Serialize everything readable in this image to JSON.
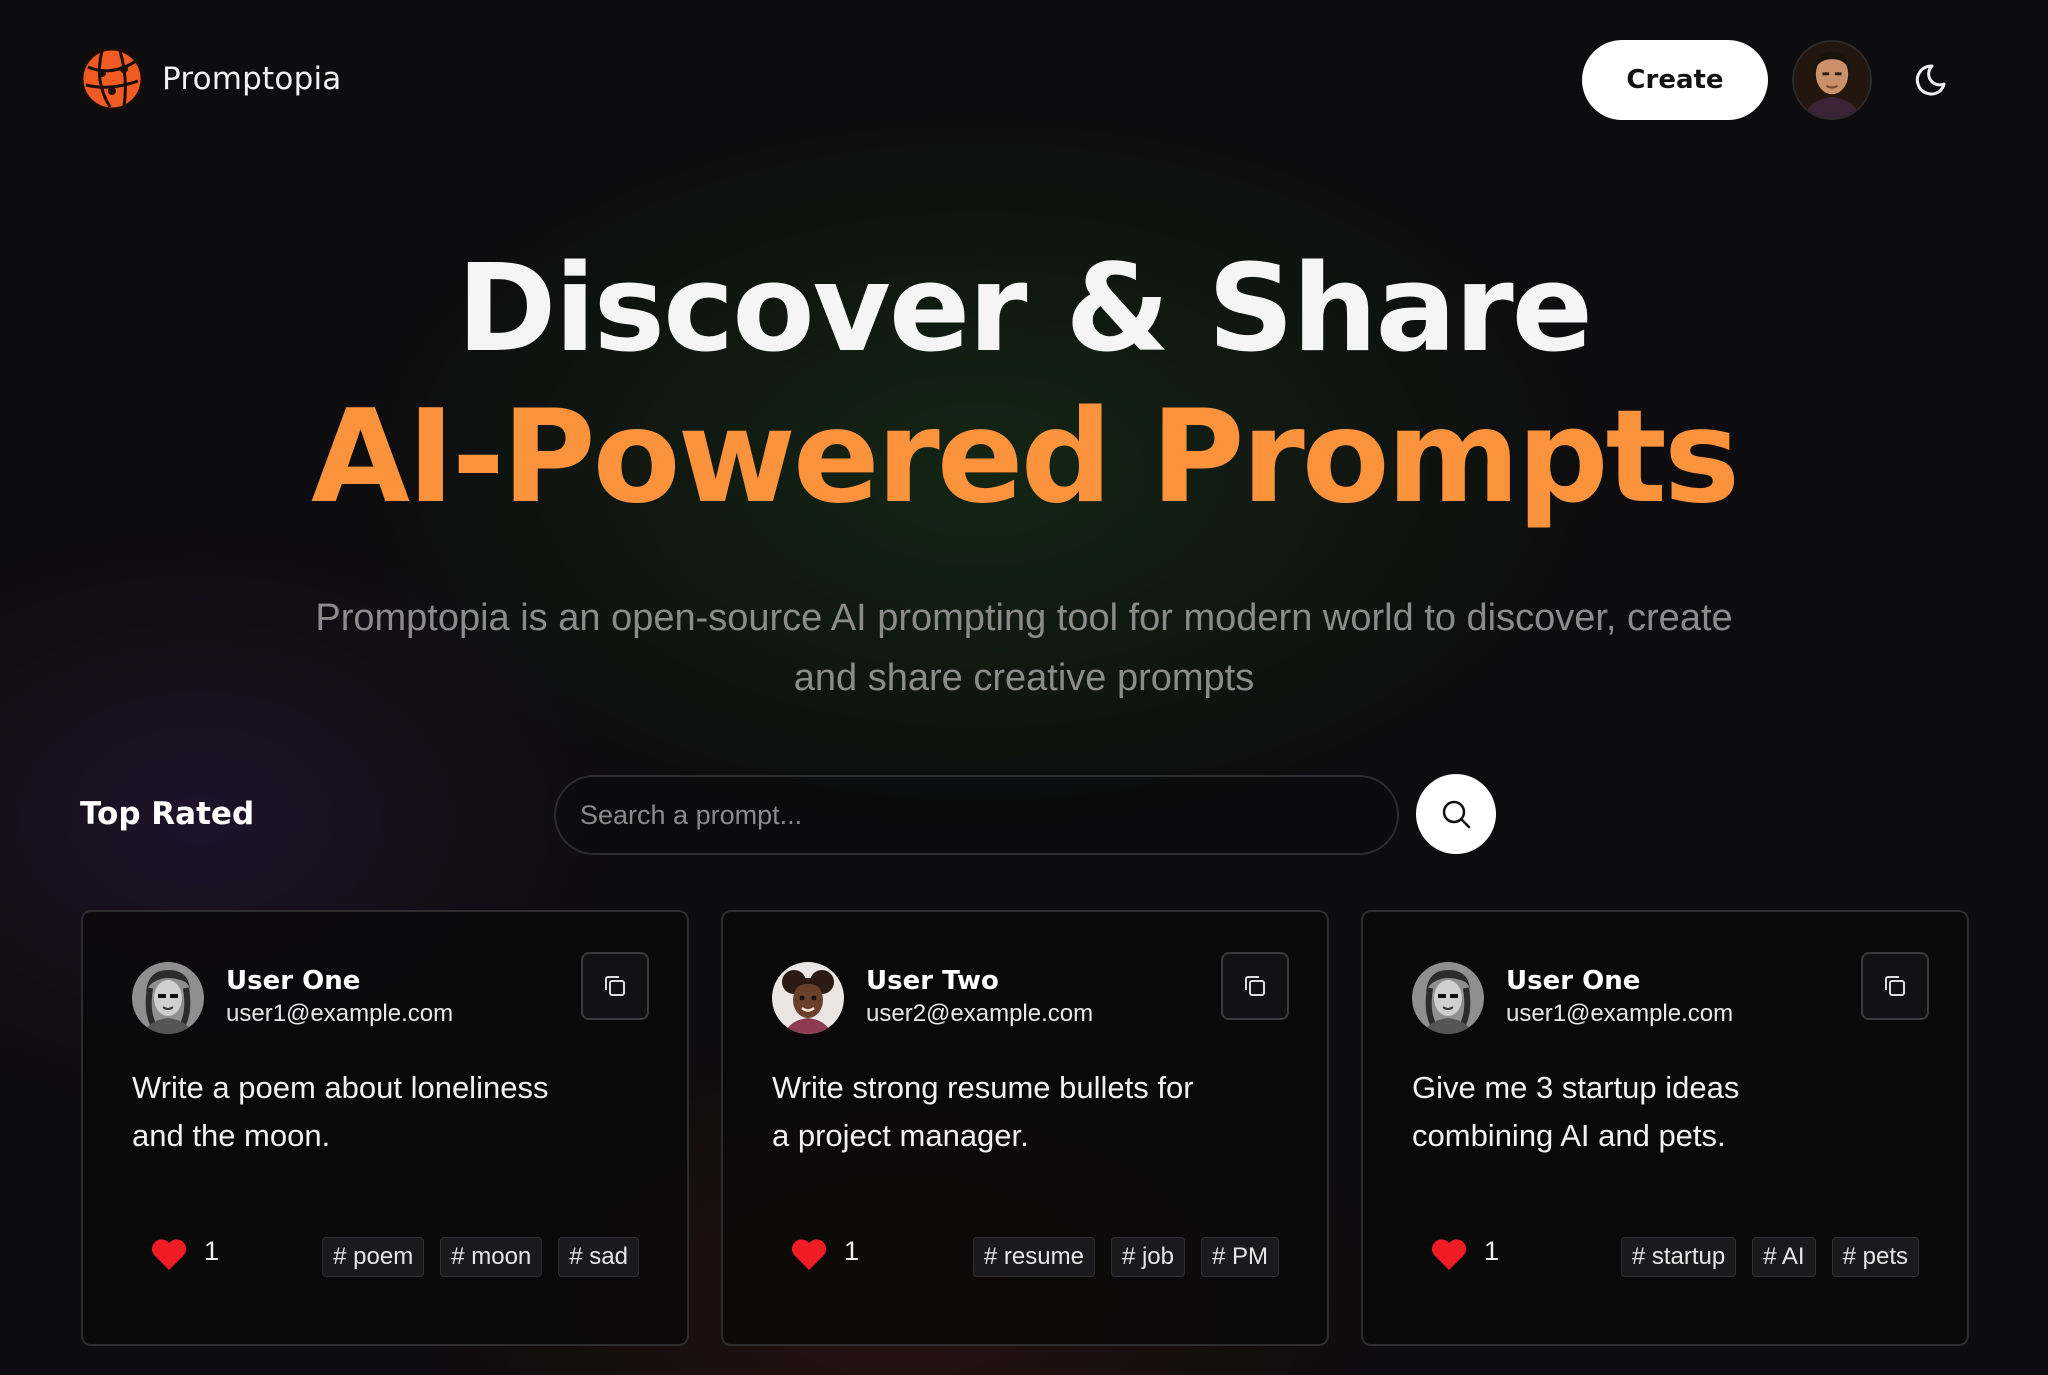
{
  "nav": {
    "brand": "Promptopia",
    "create_label": "Create"
  },
  "hero": {
    "line1": "Discover & Share",
    "line2": "AI-Powered Prompts",
    "subtitle": "Promptopia is an open-source AI prompting tool for modern world to discover, create and share creative prompts"
  },
  "feed": {
    "section_title": "Top Rated",
    "search_placeholder": "Search a prompt..."
  },
  "colors": {
    "accent": "#fb923c",
    "like": "#ef1c25",
    "background": "#0d0c0e"
  },
  "cards": [
    {
      "user_name": "User One",
      "user_email": "user1@example.com",
      "prompt": "Write a poem about loneliness and the moon.",
      "likes": "1",
      "tags": [
        "# poem",
        "# moon",
        "# sad"
      ]
    },
    {
      "user_name": "User Two",
      "user_email": "user2@example.com",
      "prompt": "Write strong resume bullets for a project manager.",
      "likes": "1",
      "tags": [
        "# resume",
        "# job",
        "# PM"
      ]
    },
    {
      "user_name": "User One",
      "user_email": "user1@example.com",
      "prompt": "Give me 3 startup ideas combining AI and pets.",
      "likes": "1",
      "tags": [
        "# startup",
        "# AI",
        "# pets"
      ]
    }
  ]
}
